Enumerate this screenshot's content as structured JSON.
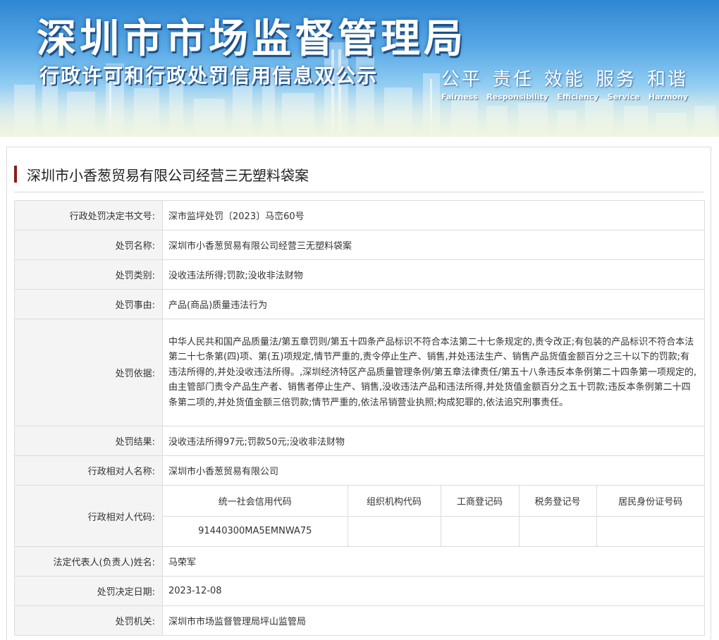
{
  "banner": {
    "title": "深圳市市场监督管理局",
    "subtitle": "行政许可和行政处罚信用信息双公示",
    "motto_cn": [
      "公平",
      "责任",
      "效能",
      "服务",
      "和谐"
    ],
    "motto_en": [
      "Fairness",
      "Responsibility",
      "Efficiency",
      "Service",
      "Harmony"
    ]
  },
  "case": {
    "title": "深圳市小香葱贸易有限公司经营三无塑料袋案"
  },
  "fields": {
    "doc_no": {
      "label": "行政处罚决定书文号:",
      "value": "深市监坪处罚〔2023〕马峦60号"
    },
    "name": {
      "label": "处罚名称:",
      "value": "深圳市小香葱贸易有限公司经营三无塑料袋案"
    },
    "category": {
      "label": "处罚类别:",
      "value": "没收违法所得;罚款;没收非法财物"
    },
    "reason": {
      "label": "处罚事由:",
      "value": "产品(商品)质量违法行为"
    },
    "basis": {
      "label": "处罚依据:",
      "value": "中华人民共和国产品质量法/第五章罚则/第五十四条产品标识不符合本法第二十七条规定的,责令改正;有包装的产品标识不符合本法第二十七条第(四)项、第(五)项规定,情节严重的,责令停止生产、销售,并处违法生产、销售产品货值金额百分之三十以下的罚款;有违法所得的,并处没收违法所得。,深圳经济特区产品质量管理条例/第五章法律责任/第五十八条违反本条例第二十四条第一项规定的,由主管部门责令产品生产者、销售者停止生产、销售,没收违法产品和违法所得,并处货值金额百分之五十罚款;违反本条例第二十四条第二项的,并处货值金额三倍罚款;情节严重的,依法吊销营业执照;构成犯罪的,依法追究刑事责任。"
    },
    "result": {
      "label": "处罚结果:",
      "value": "没收违法所得97元;罚款50元;没收非法财物"
    },
    "party_name": {
      "label": "行政相对人名称:",
      "value": "深圳市小香葱贸易有限公司"
    },
    "party_code": {
      "label": "行政相对人代码:",
      "headers": [
        "统一社会信用代码",
        "组织机构代码",
        "工商登记码",
        "税务登记号",
        "居民身份证号码"
      ],
      "values": [
        "91440300MA5EMNWA75",
        "",
        "",
        "",
        ""
      ]
    },
    "legal_rep": {
      "label": "法定代表人(负责人)姓名:",
      "value": "马荣军"
    },
    "date": {
      "label": "处罚决定日期:",
      "value": "2023-12-08"
    },
    "authority": {
      "label": "处罚机关:",
      "value": "深圳市市场监督管理局坪山监管局"
    }
  }
}
